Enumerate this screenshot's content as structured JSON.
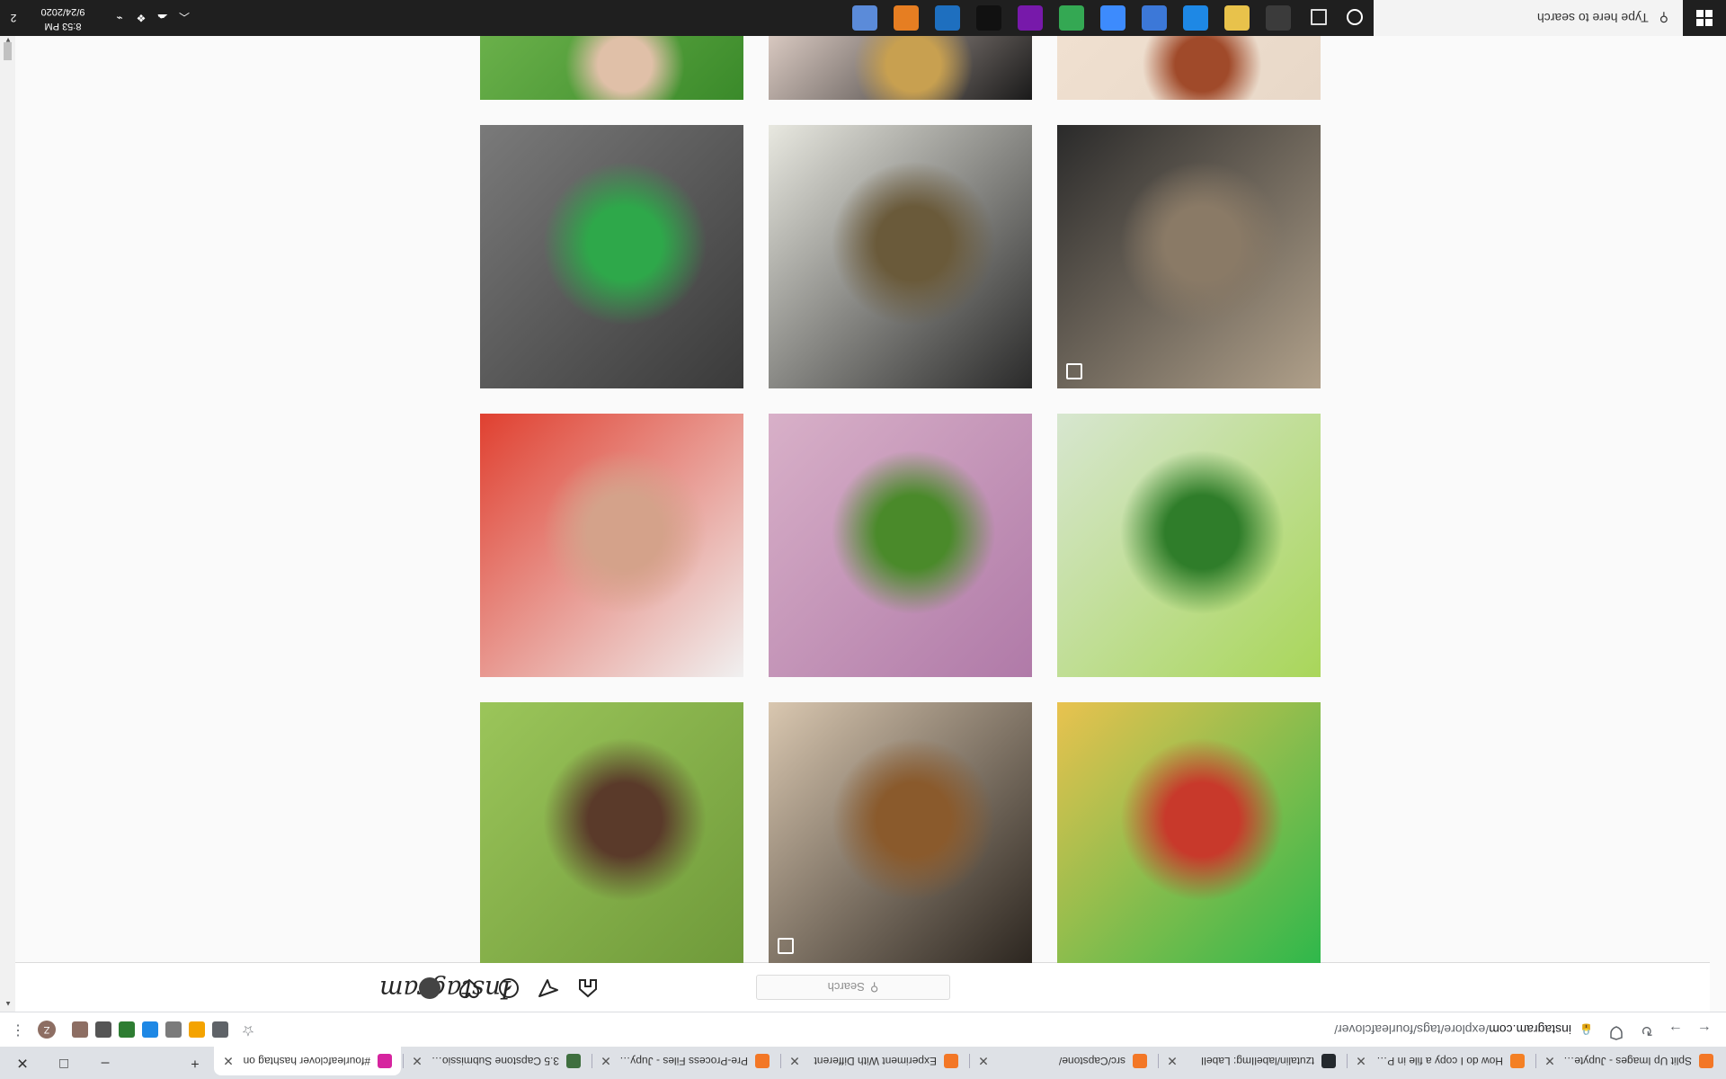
{
  "browser": {
    "tabs": [
      {
        "title": "Split Up Images - Jupyter N",
        "favicon_color": "#f37726",
        "active": false
      },
      {
        "title": "How do I copy a file in Pyth",
        "favicon_color": "#f48024",
        "active": false
      },
      {
        "title": "tzutalin/labelImg: LabelI",
        "favicon_color": "#24292e",
        "active": false
      },
      {
        "title": "src/Capstone/",
        "favicon_color": "#f37726",
        "active": false
      },
      {
        "title": "Experiment With Different",
        "favicon_color": "#f37726",
        "active": false
      },
      {
        "title": "Pre-Process Files - Jupyter",
        "favicon_color": "#f37726",
        "active": false
      },
      {
        "title": "3.5 Capstone Submission -",
        "favicon_color": "#3f6f3f",
        "active": false
      },
      {
        "title": "#fourleafclover hashtag on",
        "favicon_color": "#d6249f",
        "active": true
      }
    ],
    "new_tab_label": "+",
    "window_controls": {
      "minimize": "–",
      "maximize": "□",
      "close": "✕"
    },
    "nav": {
      "back": "←",
      "forward": "→",
      "reload": "↻"
    },
    "url": {
      "host": "instagram.com",
      "path": "/explore/tags/fourleafclover/"
    },
    "extension_colors": [
      "#5f6368",
      "#f4a300",
      "#7b7b7b",
      "#1e88e5",
      "#2e7d32",
      "#555555",
      "#8d6e63"
    ],
    "profile_initial": "Z",
    "menu_label": "⋮"
  },
  "instagram": {
    "logo": "Instagram",
    "search_placeholder": "Search",
    "grid_tiles": [
      {
        "row": 0,
        "col": 0,
        "subject": "garden toy scene",
        "colors": [
          "#2fb84b",
          "#c8392b",
          "#e9c24f"
        ],
        "multi": false
      },
      {
        "row": 0,
        "col": 1,
        "subject": "calico cat",
        "colors": [
          "#2c2620",
          "#8a5a2c",
          "#d9c7b0"
        ],
        "multi": true
      },
      {
        "row": 0,
        "col": 2,
        "subject": "brown dog on grass",
        "colors": [
          "#6f9a3a",
          "#5a3a2a",
          "#9bc55a"
        ],
        "multi": false
      },
      {
        "row": 1,
        "col": 0,
        "subject": "four-leaf clover held up",
        "colors": [
          "#a9d65a",
          "#2f7d2a",
          "#d7e6d0"
        ],
        "multi": false
      },
      {
        "row": 1,
        "col": 1,
        "subject": "clover on crochet",
        "colors": [
          "#b07aa8",
          "#4a8a2a",
          "#d8b0c8"
        ],
        "multi": false
      },
      {
        "row": 1,
        "col": 2,
        "subject": "heart clover necklace product",
        "colors": [
          "#f0f0f0",
          "#d4a28a",
          "#e04030"
        ],
        "multi": false
      },
      {
        "row": 2,
        "col": 0,
        "subject": "snake on dirt",
        "colors": [
          "#b0a08a",
          "#8a7a66",
          "#2a2a2a"
        ],
        "multi": true
      },
      {
        "row": 2,
        "col": 1,
        "subject": "sushi and okonomiyaki",
        "colors": [
          "#2a2a2a",
          "#6a5a3a",
          "#e8e8e0"
        ],
        "multi": false
      },
      {
        "row": 2,
        "col": 2,
        "subject": "clovers among leaves",
        "colors": [
          "#3a3a3a",
          "#2ea84a",
          "#7a7a7a"
        ],
        "multi": false
      },
      {
        "row": 3,
        "col": 0,
        "subject": "smiling girl",
        "colors": [
          "#e8d8c8",
          "#a04a2a",
          "#f0e0d0"
        ],
        "multi": false
      },
      {
        "row": 3,
        "col": 1,
        "subject": "beaded necklace with clover pendant",
        "colors": [
          "#1a1a1a",
          "#c8a050",
          "#d8c8c0"
        ],
        "multi": false
      },
      {
        "row": 3,
        "col": 2,
        "subject": "hand picking clover",
        "colors": [
          "#3a8a2a",
          "#e0c0a8",
          "#6ab04a"
        ],
        "multi": false
      }
    ]
  },
  "taskbar": {
    "search_placeholder": "Type here to search",
    "app_colors": [
      "#3b3b3b",
      "#e8c24b",
      "#1e88e5",
      "#3c78d8",
      "#3d8bfd",
      "#34a853",
      "#7719aa",
      "#111111",
      "#1e6fbf",
      "#e67e22",
      "#5b8bd9"
    ],
    "clock_time": "8:53 PM",
    "clock_date": "9/24/2020",
    "notification_count": "2"
  }
}
